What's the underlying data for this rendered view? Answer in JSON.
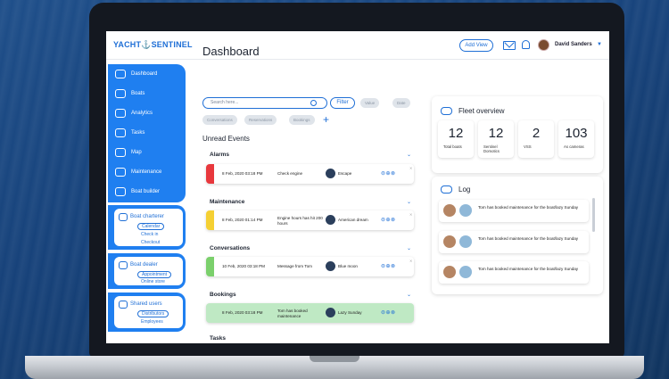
{
  "header": {
    "logo": "YACHT⚓SENTINEL",
    "add_view": "Add View",
    "user_name": "David Sanders"
  },
  "sidebar": {
    "items": [
      {
        "label": "Dashboard",
        "icon": "gauge-icon"
      },
      {
        "label": "Boats",
        "icon": "boat-icon"
      },
      {
        "label": "Analytics",
        "icon": "chart-icon"
      },
      {
        "label": "Tasks",
        "icon": "clipboard-icon"
      },
      {
        "label": "Map",
        "icon": "map-icon"
      },
      {
        "label": "Maintenance",
        "icon": "wrench-icon"
      },
      {
        "label": "Boat builder",
        "icon": "builder-icon"
      }
    ],
    "boat_charterer": {
      "title": "Boat charterer",
      "subs": [
        "Calendar",
        "Check in",
        "Checkout"
      ]
    },
    "boat_dealer": {
      "title": "Boat dealer",
      "subs": [
        "Appointment",
        "Online store"
      ]
    },
    "shared_users": {
      "title": "Shared users",
      "subs": [
        "Distributors",
        "Employees"
      ]
    }
  },
  "main": {
    "title": "Dashboard",
    "search_placeholder": "Search here...",
    "filter": "Filter",
    "chips": [
      "Value",
      "Date",
      "Conversations",
      "Reservations",
      "Bookings"
    ],
    "unread_title": "Unread Events",
    "sections": {
      "alarms": {
        "title": "Alarms",
        "row": {
          "date": "8 Feb, 2020 03:18 PM",
          "msg": "Check engine",
          "boat": "Escape"
        }
      },
      "maintenance": {
        "title": "Maintenance",
        "row": {
          "date": "8 Feb, 2020 01:14 PM",
          "msg": "Engine hours has hit 200 hours",
          "boat": "American dream"
        }
      },
      "conversations": {
        "title": "Conversations",
        "row": {
          "date": "10 Feb, 2020 03:18 PM",
          "msg": "Message from Tom",
          "boat": "Blue moon"
        }
      },
      "bookings": {
        "title": "Bookings",
        "row": {
          "date": "8 Feb, 2020 03:18 PM",
          "msg": "Tom has booked maintenance",
          "boat": "Lazy Sunday"
        }
      },
      "tasks": {
        "title": "Tasks"
      }
    },
    "row_actions": "⊜⊕⊗"
  },
  "fleet": {
    "title": "Fleet overview",
    "stats": [
      {
        "num": "12",
        "label": "Total boats"
      },
      {
        "num": "12",
        "label": "Sentinel Domotics"
      },
      {
        "num": "2",
        "label": "VSS"
      },
      {
        "num": "103",
        "label": "As cameras"
      }
    ]
  },
  "log": {
    "title": "Log",
    "entries": [
      "Tom has booked maintenance for the boat/lazy Sunday",
      "Tom has booked maintenance for the boat/lazy Sunday",
      "Tom has booked maintenance for the boat/lazy Sunday"
    ]
  },
  "colors": {
    "accent": "#1f7ff0",
    "alarm": "#e8383d",
    "maintenance": "#f5d033",
    "conversations": "#7bd06c",
    "bookings_bg": "#bfe9c4"
  }
}
